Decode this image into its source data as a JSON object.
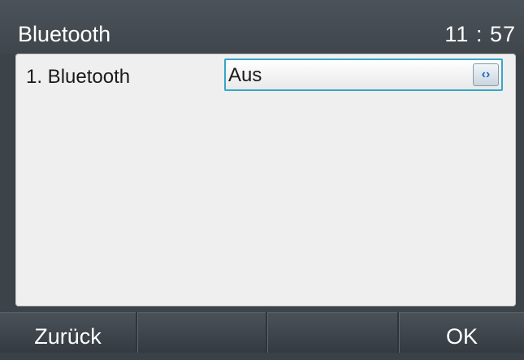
{
  "header": {
    "title": "Bluetooth",
    "clock": "11 : 57"
  },
  "settings": {
    "rows": [
      {
        "label": "1. Bluetooth",
        "value": "Aus",
        "arrows_icon": "left-right-arrows-icon"
      }
    ]
  },
  "softkeys": {
    "key1": "Zurück",
    "key2": "",
    "key3": "",
    "key4": "OK"
  },
  "colors": {
    "accent": "#37a6c9",
    "arrow": "#1867c9"
  }
}
